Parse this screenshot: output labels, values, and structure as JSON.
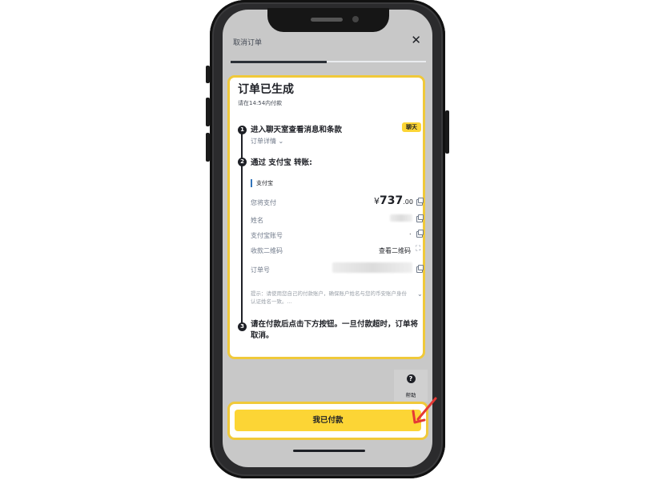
{
  "header": {
    "title": "取消订单",
    "close_icon": "close-icon"
  },
  "order": {
    "title": "订单已生成",
    "subtitle": "请在14:54内付款"
  },
  "steps": [
    {
      "num": "1",
      "text": "进入聊天室查看消息和条款"
    },
    {
      "num": "2",
      "text": "通过 支付宝 转账:"
    },
    {
      "num": "3",
      "text": "请在付款后点击下方按钮。一旦付款超时，订单将取消。"
    }
  ],
  "chat_button": "聊天",
  "order_details_link": "订单详情",
  "payment_method": "支付宝",
  "rows": {
    "amount_label": "您将支付",
    "amount_symbol": "¥",
    "amount_int": "737",
    "amount_dec": ".00",
    "name_label": "姓名",
    "account_label": "支付宝账号",
    "account_value": ".",
    "qr_label": "收款二维码",
    "qr_link": "查看二维码",
    "order_no_label": "订单号"
  },
  "hint": "提示：请使用您自己的付款账户，确保账户姓名与您的币安账户身份认证姓名一致。...",
  "help": {
    "label": "帮助",
    "glyph": "?"
  },
  "paid_button": "我已付款",
  "colors": {
    "accent": "#fcd535",
    "highlight_border": "#f0c93a",
    "arrow": "#e53935"
  }
}
